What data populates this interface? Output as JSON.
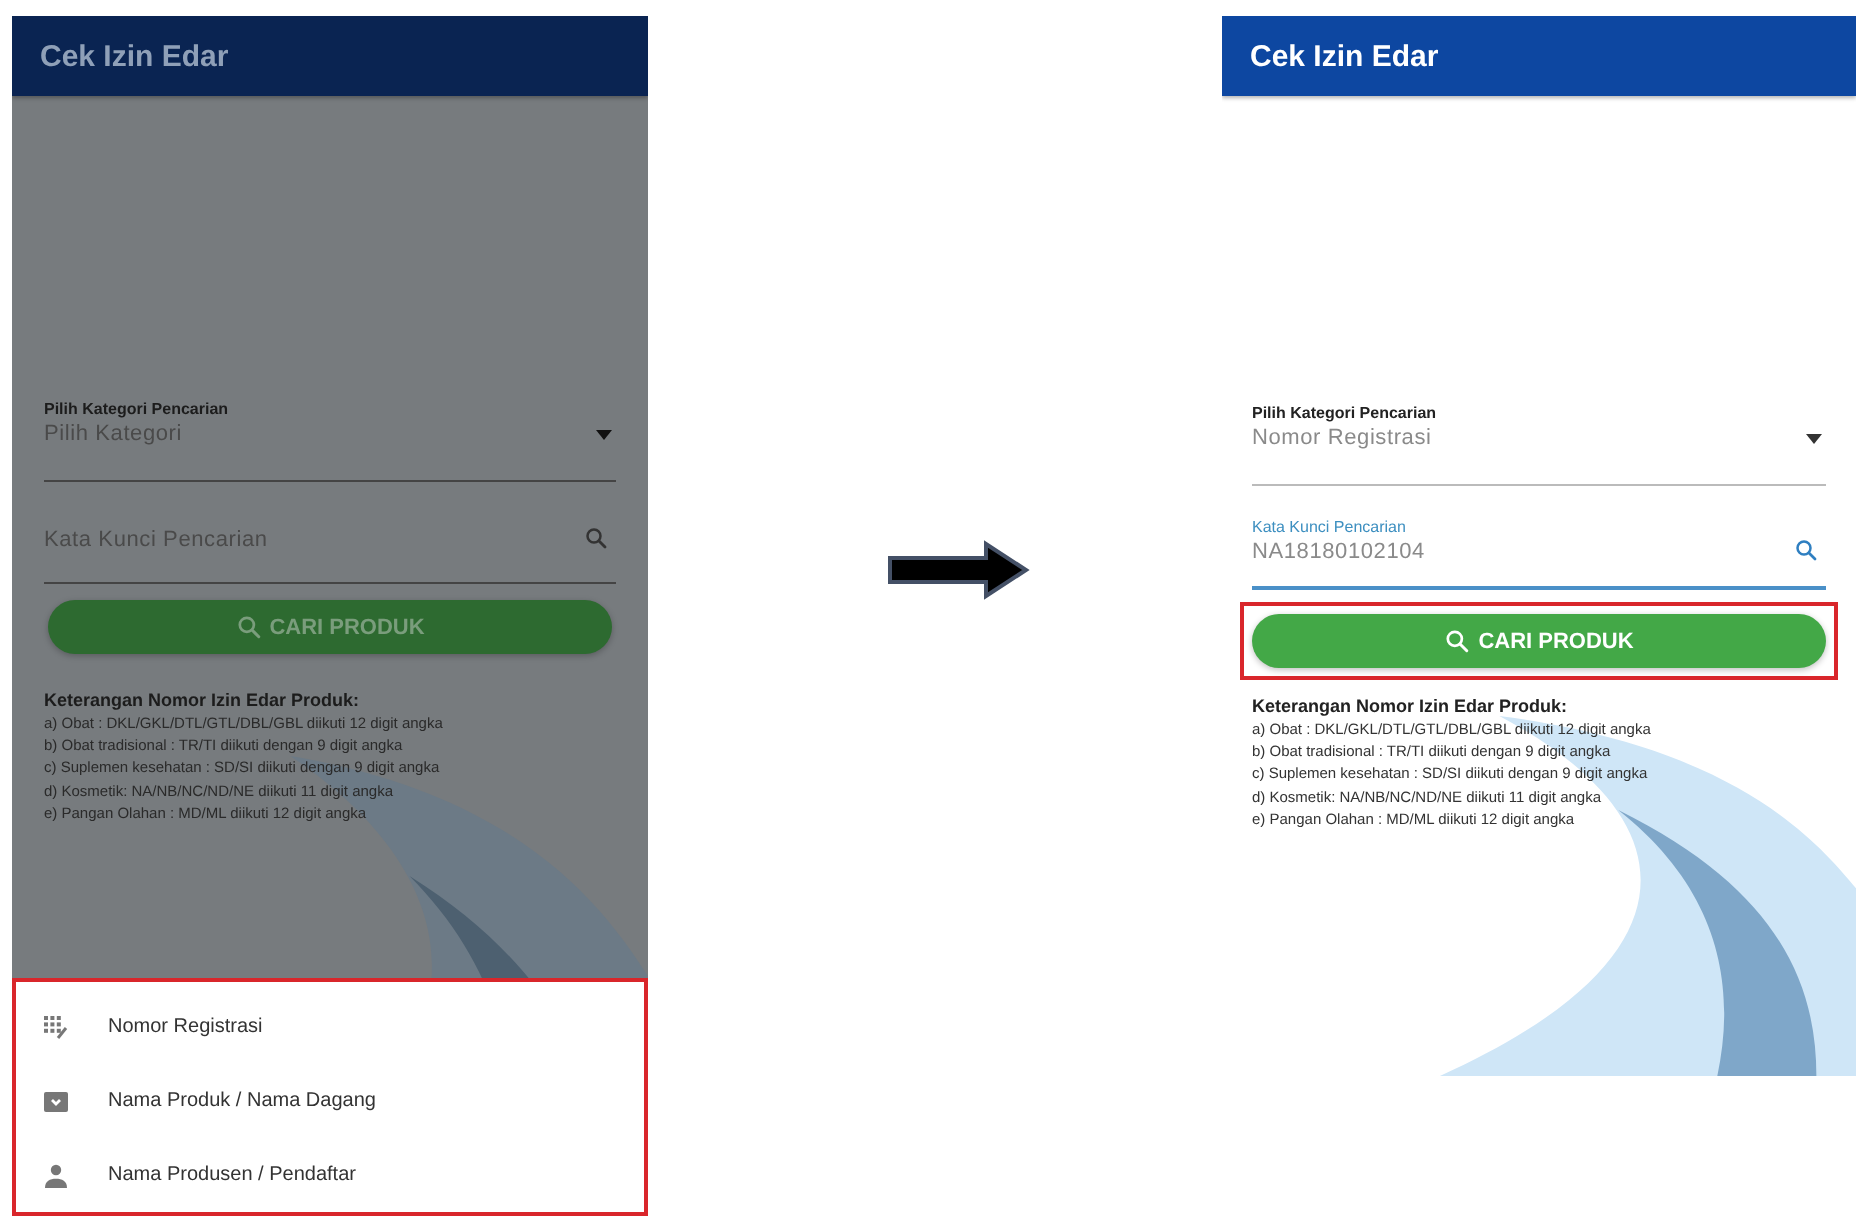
{
  "screens": [
    {
      "dimmed": true,
      "title": "Cek Izin Edar",
      "category": {
        "label": "Pilih Kategori Pencarian",
        "value": "Pilih Kategori"
      },
      "keyword": {
        "placeholder": "Kata Kunci Pencarian"
      },
      "button": {
        "label": "CARI PRODUK",
        "highlighted": false
      },
      "notes": {
        "title": "Keterangan Nomor Izin Edar Produk:",
        "lines": [
          "a) Obat : DKL/GKL/DTL/GTL/DBL/GBL diikuti 12 digit angka",
          "b) Obat tradisional : TR/TI diikuti dengan 9 digit angka",
          "c) Suplemen kesehatan : SD/SI diikuti dengan 9 digit angka",
          "d) Kosmetik: NA/NB/NC/ND/NE diikuti 11 digit angka",
          "e) Pangan Olahan : MD/ML diikuti 12 digit angka"
        ]
      },
      "menu": {
        "highlighted": true,
        "items": [
          "Nomor Registrasi",
          "Nama Produk / Nama Dagang",
          "Nama Produsen / Pendaftar"
        ]
      }
    },
    {
      "dimmed": false,
      "title": "Cek Izin Edar",
      "category": {
        "label": "Pilih Kategori Pencarian",
        "value": "Nomor Registrasi"
      },
      "keyword": {
        "label": "Kata Kunci Pencarian",
        "value": "NA18180102104"
      },
      "button": {
        "label": "CARI PRODUK",
        "highlighted": true
      },
      "notes": {
        "title": "Keterangan Nomor Izin Edar Produk:",
        "lines": [
          "a) Obat : DKL/GKL/DTL/GTL/DBL/GBL diikuti 12 digit angka",
          "b) Obat tradisional : TR/TI diikuti dengan 9 digit angka",
          "c) Suplemen kesehatan : SD/SI diikuti dengan 9 digit angka",
          "d) Kosmetik: NA/NB/NC/ND/NE diikuti 11 digit angka",
          "e) Pangan Olahan : MD/ML diikuti 12 digit angka"
        ]
      }
    }
  ]
}
